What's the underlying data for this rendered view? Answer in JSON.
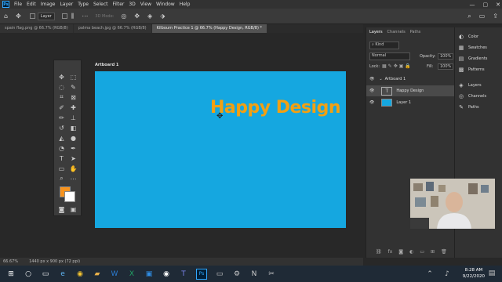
{
  "app": {
    "logo": "Ps",
    "menu": [
      "File",
      "Edit",
      "Image",
      "Layer",
      "Type",
      "Select",
      "Filter",
      "3D",
      "View",
      "Window",
      "Help"
    ],
    "window_controls": [
      "—",
      "▢",
      "✕"
    ]
  },
  "options_bar": {
    "tool_select": "Layer",
    "mode_3d": "3D Mode:"
  },
  "tabs": [
    {
      "label": "spain flag.png @ 66.7% (RGB/8)",
      "active": false
    },
    {
      "label": "palma beach.jpg @ 66.7% (RGB/8)",
      "active": false
    },
    {
      "label": "Kilbourn Practice 1 @ 66.7% (Happy Design, RGB/8) *",
      "active": true
    }
  ],
  "canvas": {
    "artboard_label": "Artboard 1",
    "headline": "Happy Design",
    "artboard_color": "#15a7e0",
    "headline_color": "#f2a012"
  },
  "status": {
    "zoom": "66.67%",
    "doc_size": "1440 px x 900 px (72 ppi)"
  },
  "layers_panel": {
    "tabs": [
      "Layers",
      "Channels",
      "Paths"
    ],
    "kind_filter": "Kind",
    "blend_mode": "Normal",
    "opacity_label": "Opacity:",
    "opacity_value": "100%",
    "lock_label": "Lock:",
    "fill_label": "Fill:",
    "fill_value": "100%",
    "layers": [
      {
        "name": "Artboard 1",
        "type": "artboard"
      },
      {
        "name": "Happy Design",
        "type": "text"
      },
      {
        "name": "Layer 1",
        "type": "pixel"
      }
    ]
  },
  "side_panel": {
    "group1": [
      "Color",
      "Swatches",
      "Gradients",
      "Patterns"
    ],
    "group2": [
      "Layers",
      "Channels",
      "Paths"
    ]
  },
  "swatches": {
    "foreground": "#f7931e",
    "background": "#ffffff"
  },
  "taskbar": {
    "time": "8:28 AM",
    "date": "9/22/2020"
  }
}
